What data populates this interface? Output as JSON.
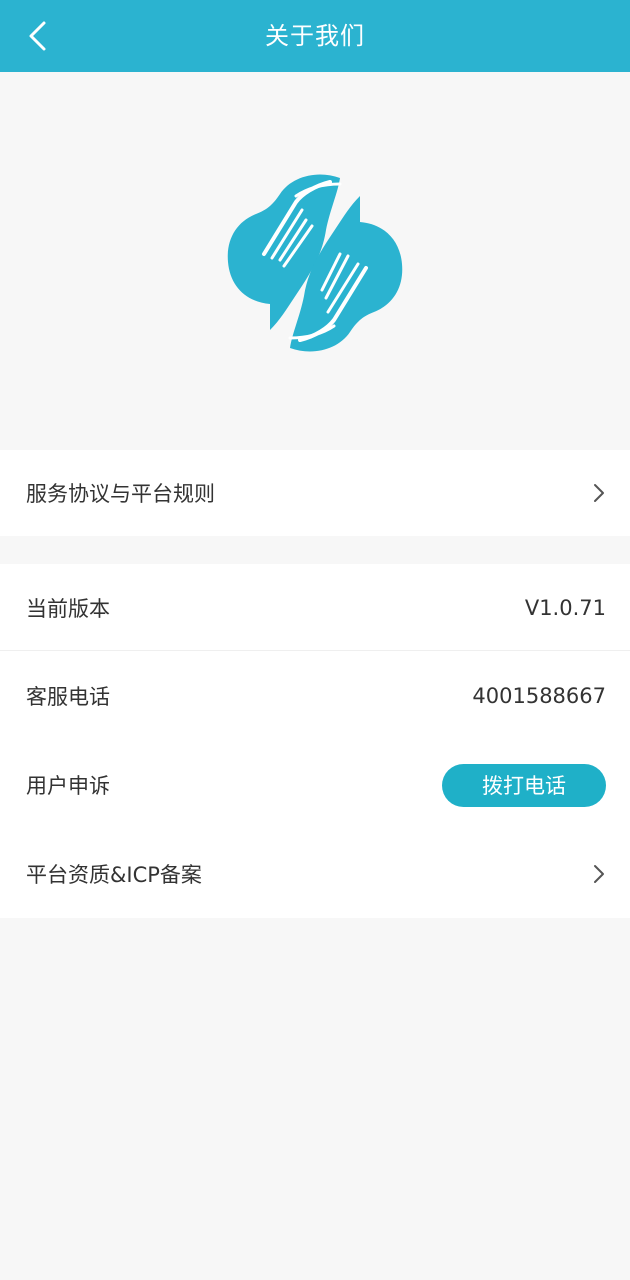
{
  "header": {
    "title": "关于我们",
    "back_icon": "chevron-left-icon"
  },
  "logo": {
    "icon": "hands-cloud-logo",
    "color": "#2bb3d0"
  },
  "section1": {
    "service_agreement": {
      "label": "服务协议与平台规则",
      "icon": "chevron-right-icon"
    }
  },
  "section2": {
    "version": {
      "label": "当前版本",
      "value": "V1.0.71"
    },
    "hotline": {
      "label": "客服电话",
      "value": "4001588667"
    },
    "complaint": {
      "label": "用户申诉",
      "button_label": "拨打电话"
    },
    "qualification": {
      "label": "平台资质&ICP备案",
      "icon": "chevron-right-icon"
    }
  },
  "colors": {
    "header_bg": "#2bb3d0",
    "button_bg": "#1fb0c8",
    "page_bg": "#f7f7f7"
  }
}
